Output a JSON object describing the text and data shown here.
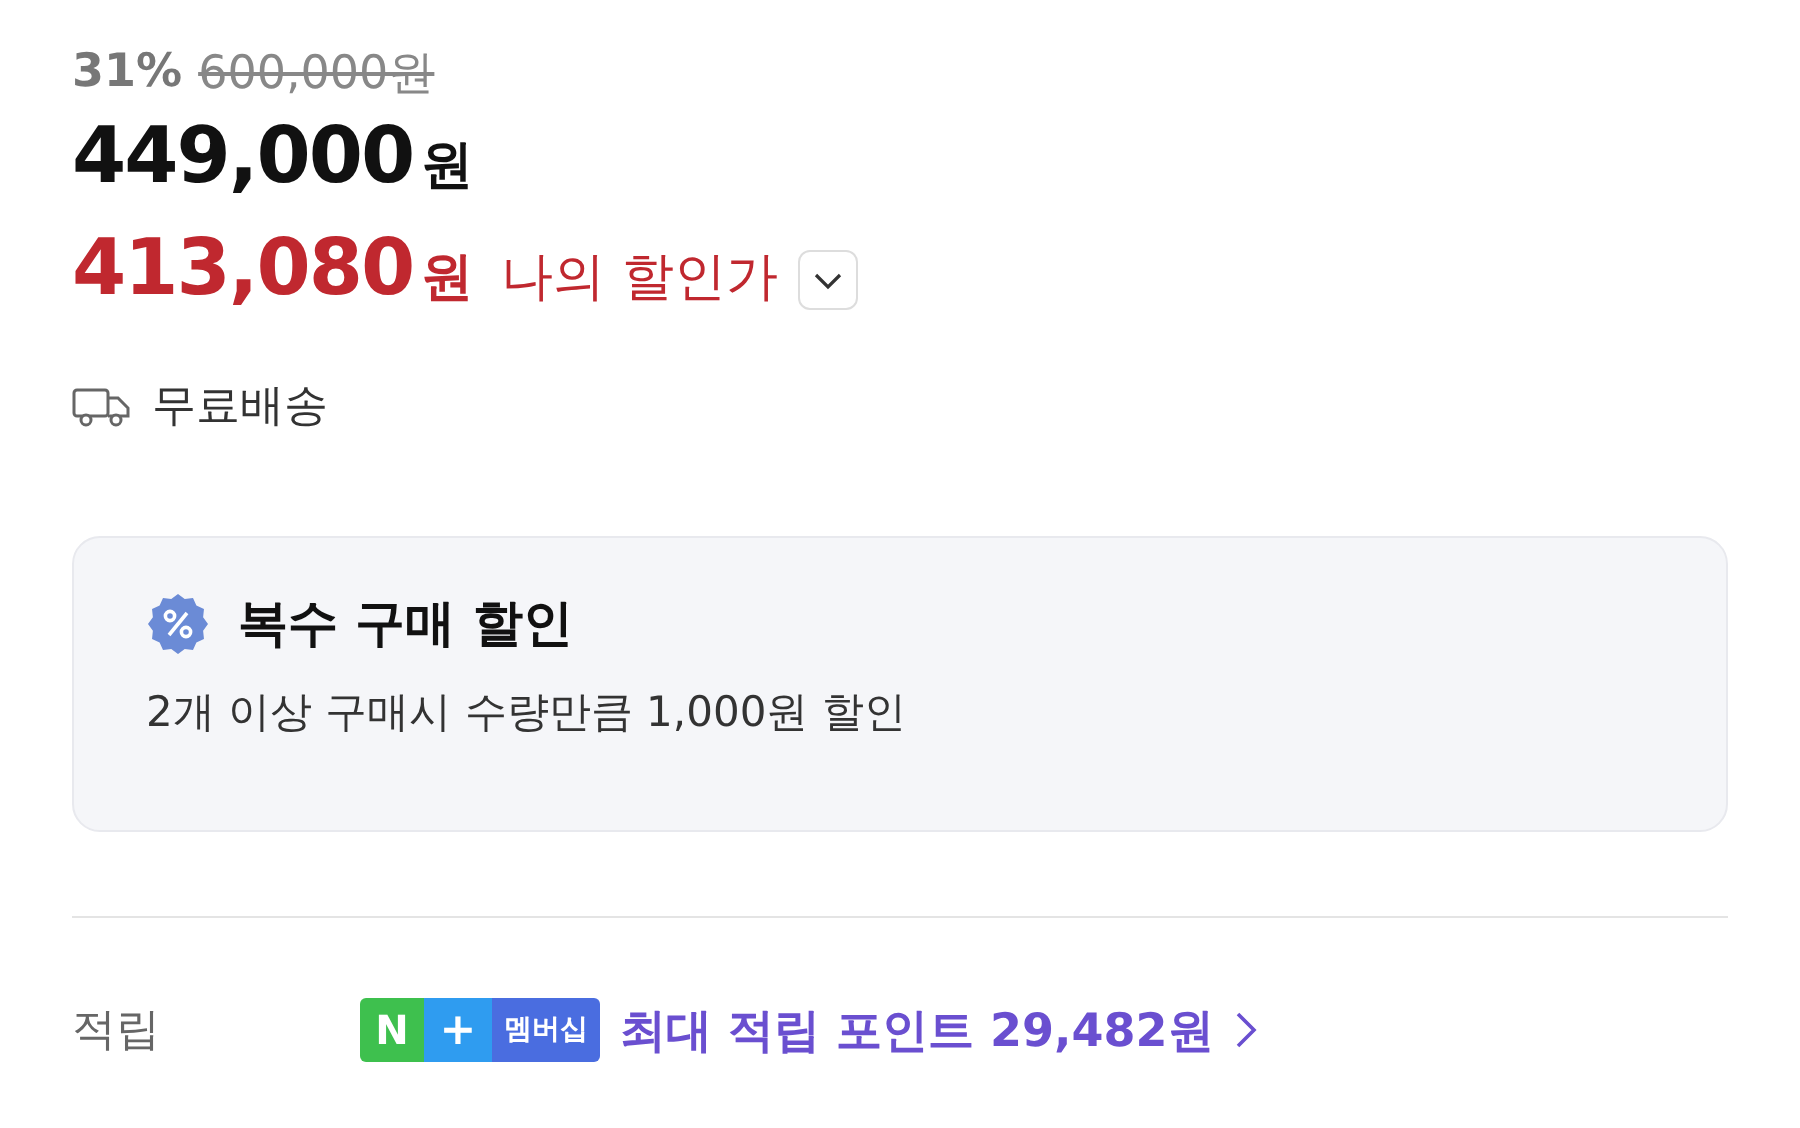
{
  "price": {
    "discount_rate": "31%",
    "original_price": "600,000원",
    "sale_amount": "449,000",
    "sale_unit": "원",
    "my_amount": "413,080",
    "my_unit": "원",
    "my_label": "나의 할인가"
  },
  "shipping": {
    "label": "무료배송"
  },
  "promo": {
    "title": "복수 구매 할인",
    "description": "2개 이상 구매시 수량만큼 1,000원 할인"
  },
  "points": {
    "label": "적립",
    "badge": [
      "N",
      "+",
      "멤버십"
    ],
    "text": "최대 적립 포인트 29,482원"
  }
}
